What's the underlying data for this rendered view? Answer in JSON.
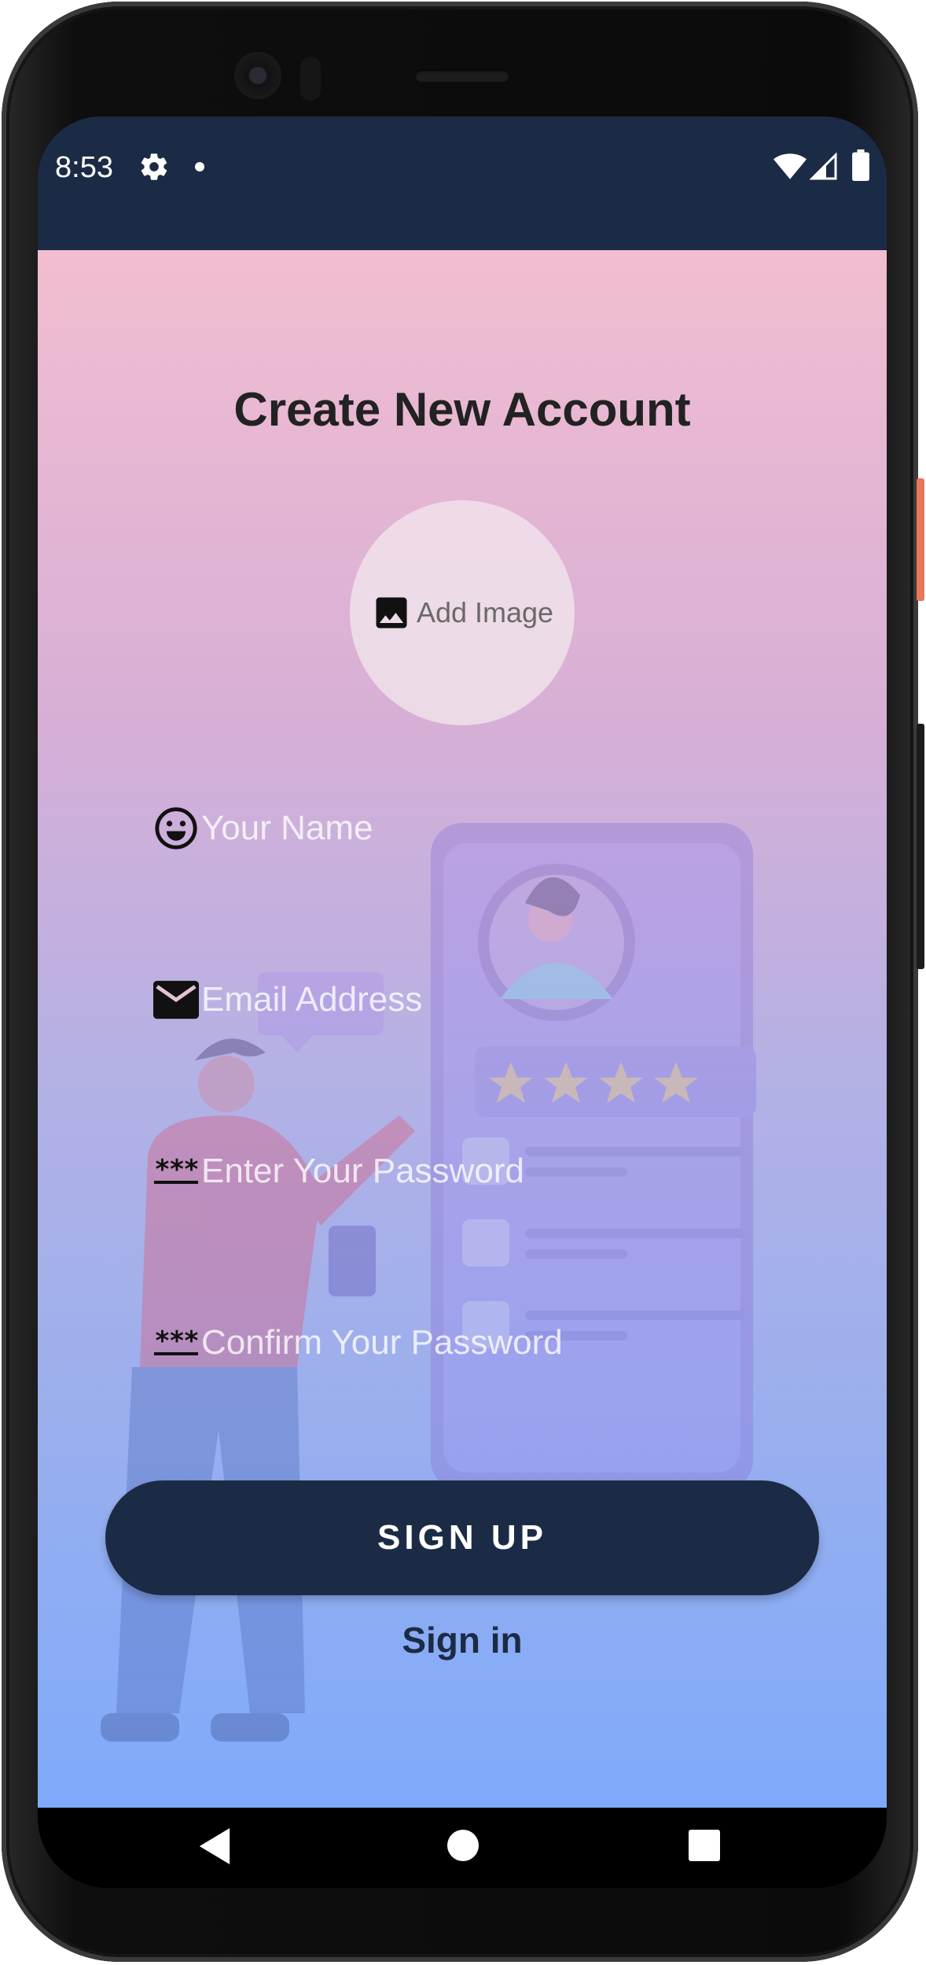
{
  "status_bar": {
    "time": "8:53",
    "icons": [
      "gear-icon",
      "notification-dot-icon",
      "wifi-icon",
      "signal-icon",
      "battery-icon"
    ]
  },
  "page": {
    "title": "Create New Account"
  },
  "avatar_picker": {
    "icon": "image-icon",
    "label": "Add Image"
  },
  "form": {
    "name": {
      "icon": "smiley-icon",
      "placeholder": "Your Name",
      "value": ""
    },
    "email": {
      "icon": "mail-icon",
      "placeholder": "Email Address",
      "value": ""
    },
    "password": {
      "icon": "password-icon",
      "icon_text": "***",
      "placeholder": "Enter Your Password",
      "value": ""
    },
    "confirm_password": {
      "icon": "password-icon",
      "icon_text": "***",
      "placeholder": "Confirm Your Password",
      "value": ""
    }
  },
  "actions": {
    "signup_label": "SIGN UP",
    "signin_label": "Sign in"
  },
  "nav_bar": {
    "icons": [
      "back-icon",
      "home-icon",
      "recents-icon"
    ]
  },
  "colors": {
    "primary": "#1c2b45",
    "gradient_top": "#f2bdd0",
    "gradient_bottom": "#7faafb"
  }
}
